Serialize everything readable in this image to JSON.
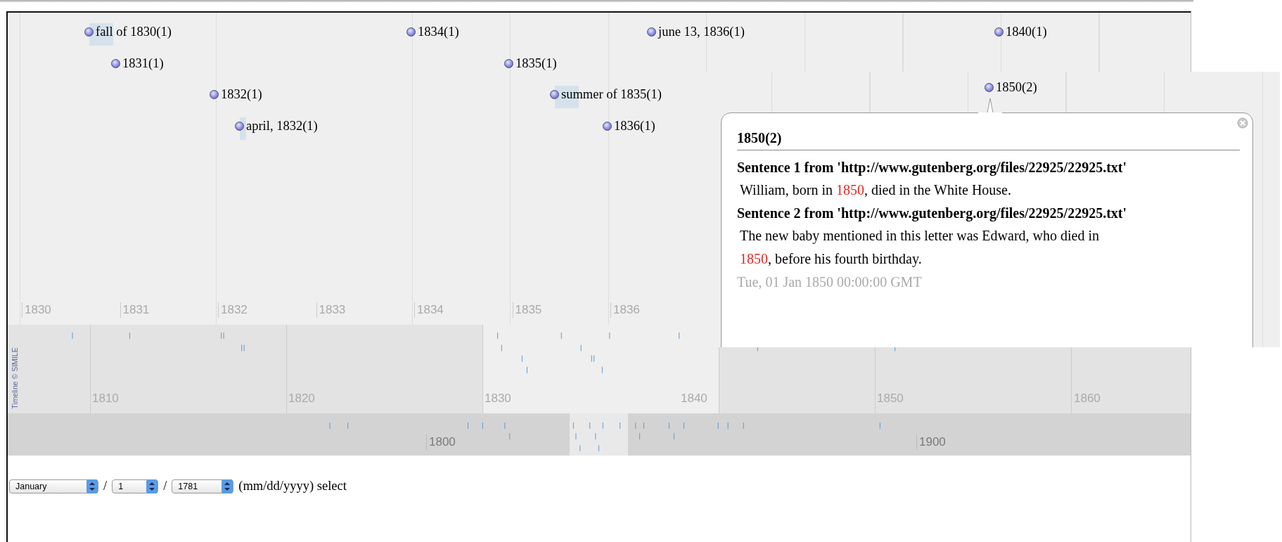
{
  "events": [
    {
      "label": "fall of 1830(1)",
      "kind": "season"
    },
    {
      "label": "1834(1)",
      "kind": "instant"
    },
    {
      "label": "june 13, 1836(1)",
      "kind": "instant"
    },
    {
      "label": "1840(1)",
      "kind": "instant"
    },
    {
      "label": "1831(1)",
      "kind": "instant"
    },
    {
      "label": "1835(1)",
      "kind": "instant"
    },
    {
      "label": "1850(2)",
      "kind": "instant"
    },
    {
      "label": "1832(1)",
      "kind": "instant"
    },
    {
      "label": "summer of 1835(1)",
      "kind": "season"
    },
    {
      "label": "april, 1832(1)",
      "kind": "month"
    },
    {
      "label": "1836(1)",
      "kind": "instant"
    }
  ],
  "detail_band": {
    "year_labels": [
      "1830",
      "1831",
      "1832",
      "1833",
      "1834",
      "1835",
      "1836"
    ]
  },
  "decade_band": {
    "year_labels": [
      "1810",
      "1820",
      "1830",
      "1840",
      "1850",
      "1860"
    ]
  },
  "century_band": {
    "year_labels": [
      "1800",
      "1900"
    ]
  },
  "credit": "Timeline © SIMILE",
  "popup": {
    "title": "1850(2)",
    "sentences": [
      {
        "heading": "Sentence 1 from 'http://www.gutenberg.org/files/22925/22925.txt'",
        "parts": [
          {
            "text": " William, born in ",
            "highlight": false
          },
          {
            "text": "1850",
            "highlight": true
          },
          {
            "text": ", died in the White House.",
            "highlight": false
          }
        ]
      },
      {
        "heading": "Sentence 2 from 'http://www.gutenberg.org/files/22925/22925.txt'",
        "parts": [
          {
            "text": " The new baby mentioned in this letter was Edward, who died in ",
            "highlight": false
          },
          {
            "text": "1850",
            "highlight": true
          },
          {
            "text": ", before his fourth birthday.",
            "highlight": false
          }
        ]
      }
    ],
    "date": "Tue, 01 Jan 1850 00:00:00 GMT"
  },
  "date_form": {
    "month": {
      "value": "January"
    },
    "separator_1": "/",
    "day": {
      "value": "1"
    },
    "separator_2": "/",
    "year": {
      "value": "1781"
    },
    "hint": "(mm/dd/yyyy) select"
  }
}
